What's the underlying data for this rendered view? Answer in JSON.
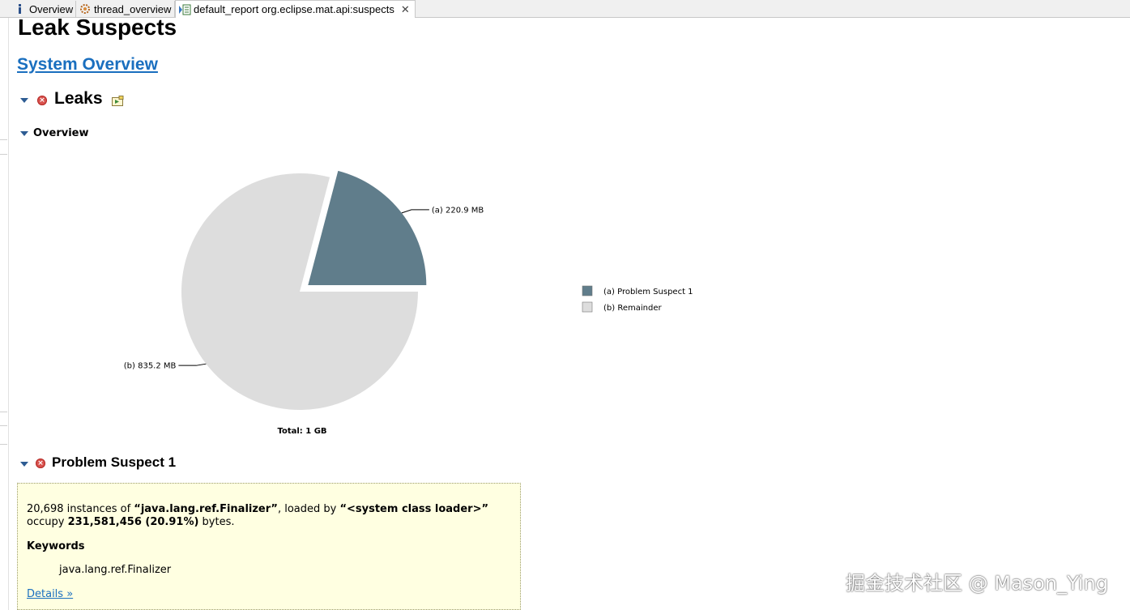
{
  "tabs": [
    {
      "label": "Overview",
      "icon": "info-icon"
    },
    {
      "label": "thread_overview",
      "icon": "gear-thread-icon"
    },
    {
      "label": "default_report org.eclipse.mat.api:suspects",
      "icon": "report-icon",
      "active": true,
      "close_symbol": "✕"
    }
  ],
  "page": {
    "title": "Leak Suspects",
    "system_overview_link": "System Overview"
  },
  "leaks_section": {
    "title": "Leaks"
  },
  "overview_section": {
    "title": "Overview"
  },
  "chart_data": {
    "type": "pie",
    "slices": [
      {
        "id": "(a)",
        "label": "Problem Suspect 1",
        "value_mb": 220.9,
        "value_label": "220.9 MB",
        "color": "#607d8b",
        "exploded": true
      },
      {
        "id": "(b)",
        "label": "Remainder",
        "value_mb": 835.2,
        "value_label": "835.2 MB",
        "color": "#dddddd",
        "exploded": false
      }
    ],
    "total_label": "Total: 1 GB",
    "legend_position": "right"
  },
  "suspect_section": {
    "title": "Problem Suspect 1",
    "desc": {
      "count": "20,698",
      "instances_of": " instances of ",
      "class_name": "“java.lang.ref.Finalizer”",
      "loaded_by": ", loaded by ",
      "loader": "“<system class loader>”",
      "occupy": "occupy ",
      "bytes": "231,581,456 (20.91%)",
      "bytes_suffix": " bytes."
    },
    "keywords_label": "Keywords",
    "keyword": "java.lang.ref.Finalizer",
    "details_link": "Details »"
  },
  "watermark": "掘金技术社区 @ Mason_Ying"
}
